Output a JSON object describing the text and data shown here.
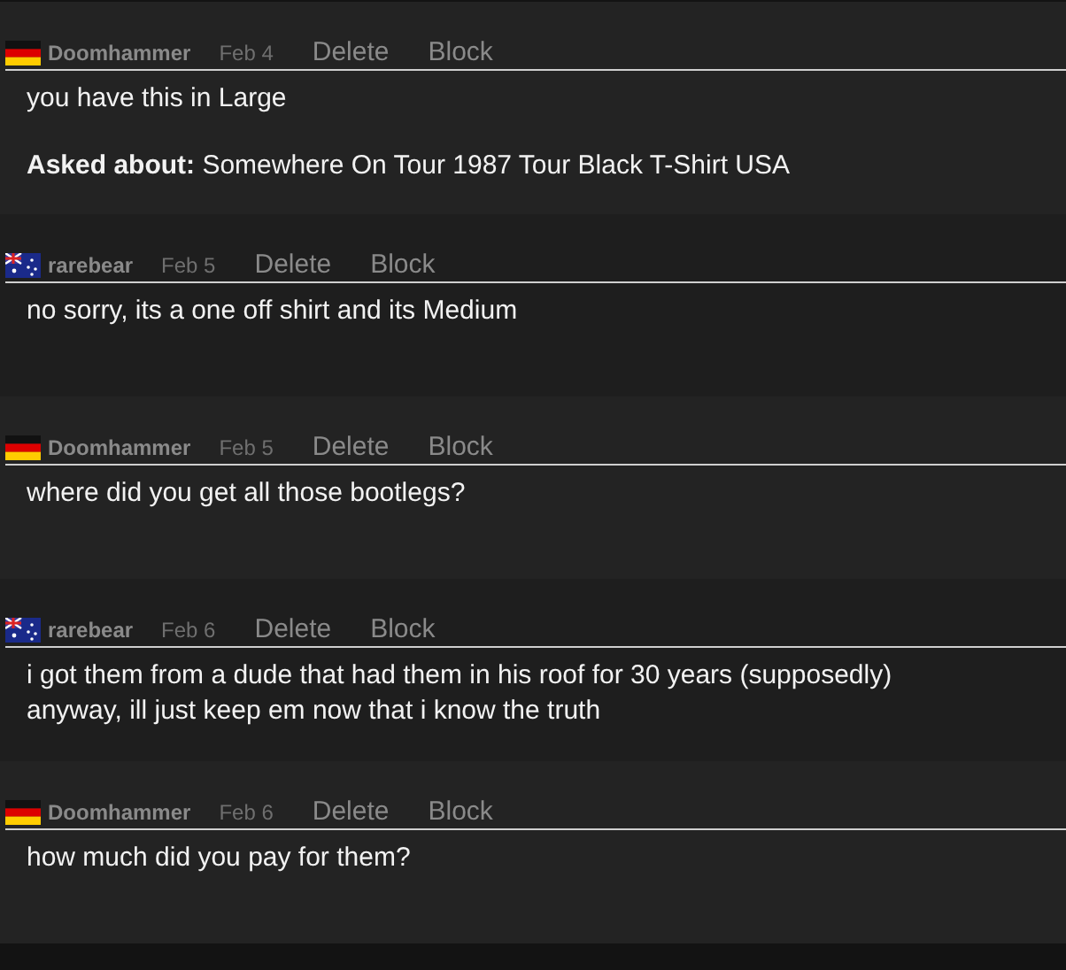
{
  "messages": [
    {
      "user": "Doomhammer",
      "kind": "germany",
      "date": "Feb 4",
      "actions": [
        "Delete",
        "Block"
      ],
      "lines": [
        "you have this in Large"
      ],
      "asked_about": {
        "label": "Asked about:",
        "item": "Somewhere On Tour 1987 Tour Black T-Shirt USA"
      }
    },
    {
      "user": "rarebear",
      "kind": "australia",
      "date": "Feb 5",
      "actions": [
        "Delete",
        "Block"
      ],
      "lines": [
        "no sorry, its a one off shirt and its Medium"
      ]
    },
    {
      "user": "Doomhammer",
      "kind": "germany",
      "date": "Feb 5",
      "actions": [
        "Delete",
        "Block"
      ],
      "lines": [
        "where did you get all those bootlegs?"
      ]
    },
    {
      "user": "rarebear",
      "kind": "australia",
      "date": "Feb 6",
      "actions": [
        "Delete",
        "Block"
      ],
      "lines": [
        "i got them from a dude that had them in his roof for 30 years (supposedly)",
        "anyway, ill just keep em now that i know the truth"
      ]
    },
    {
      "user": "Doomhammer",
      "kind": "germany",
      "date": "Feb 6",
      "actions": [
        "Delete",
        "Block"
      ],
      "lines": [
        "how much did you pay for them?"
      ]
    }
  ]
}
